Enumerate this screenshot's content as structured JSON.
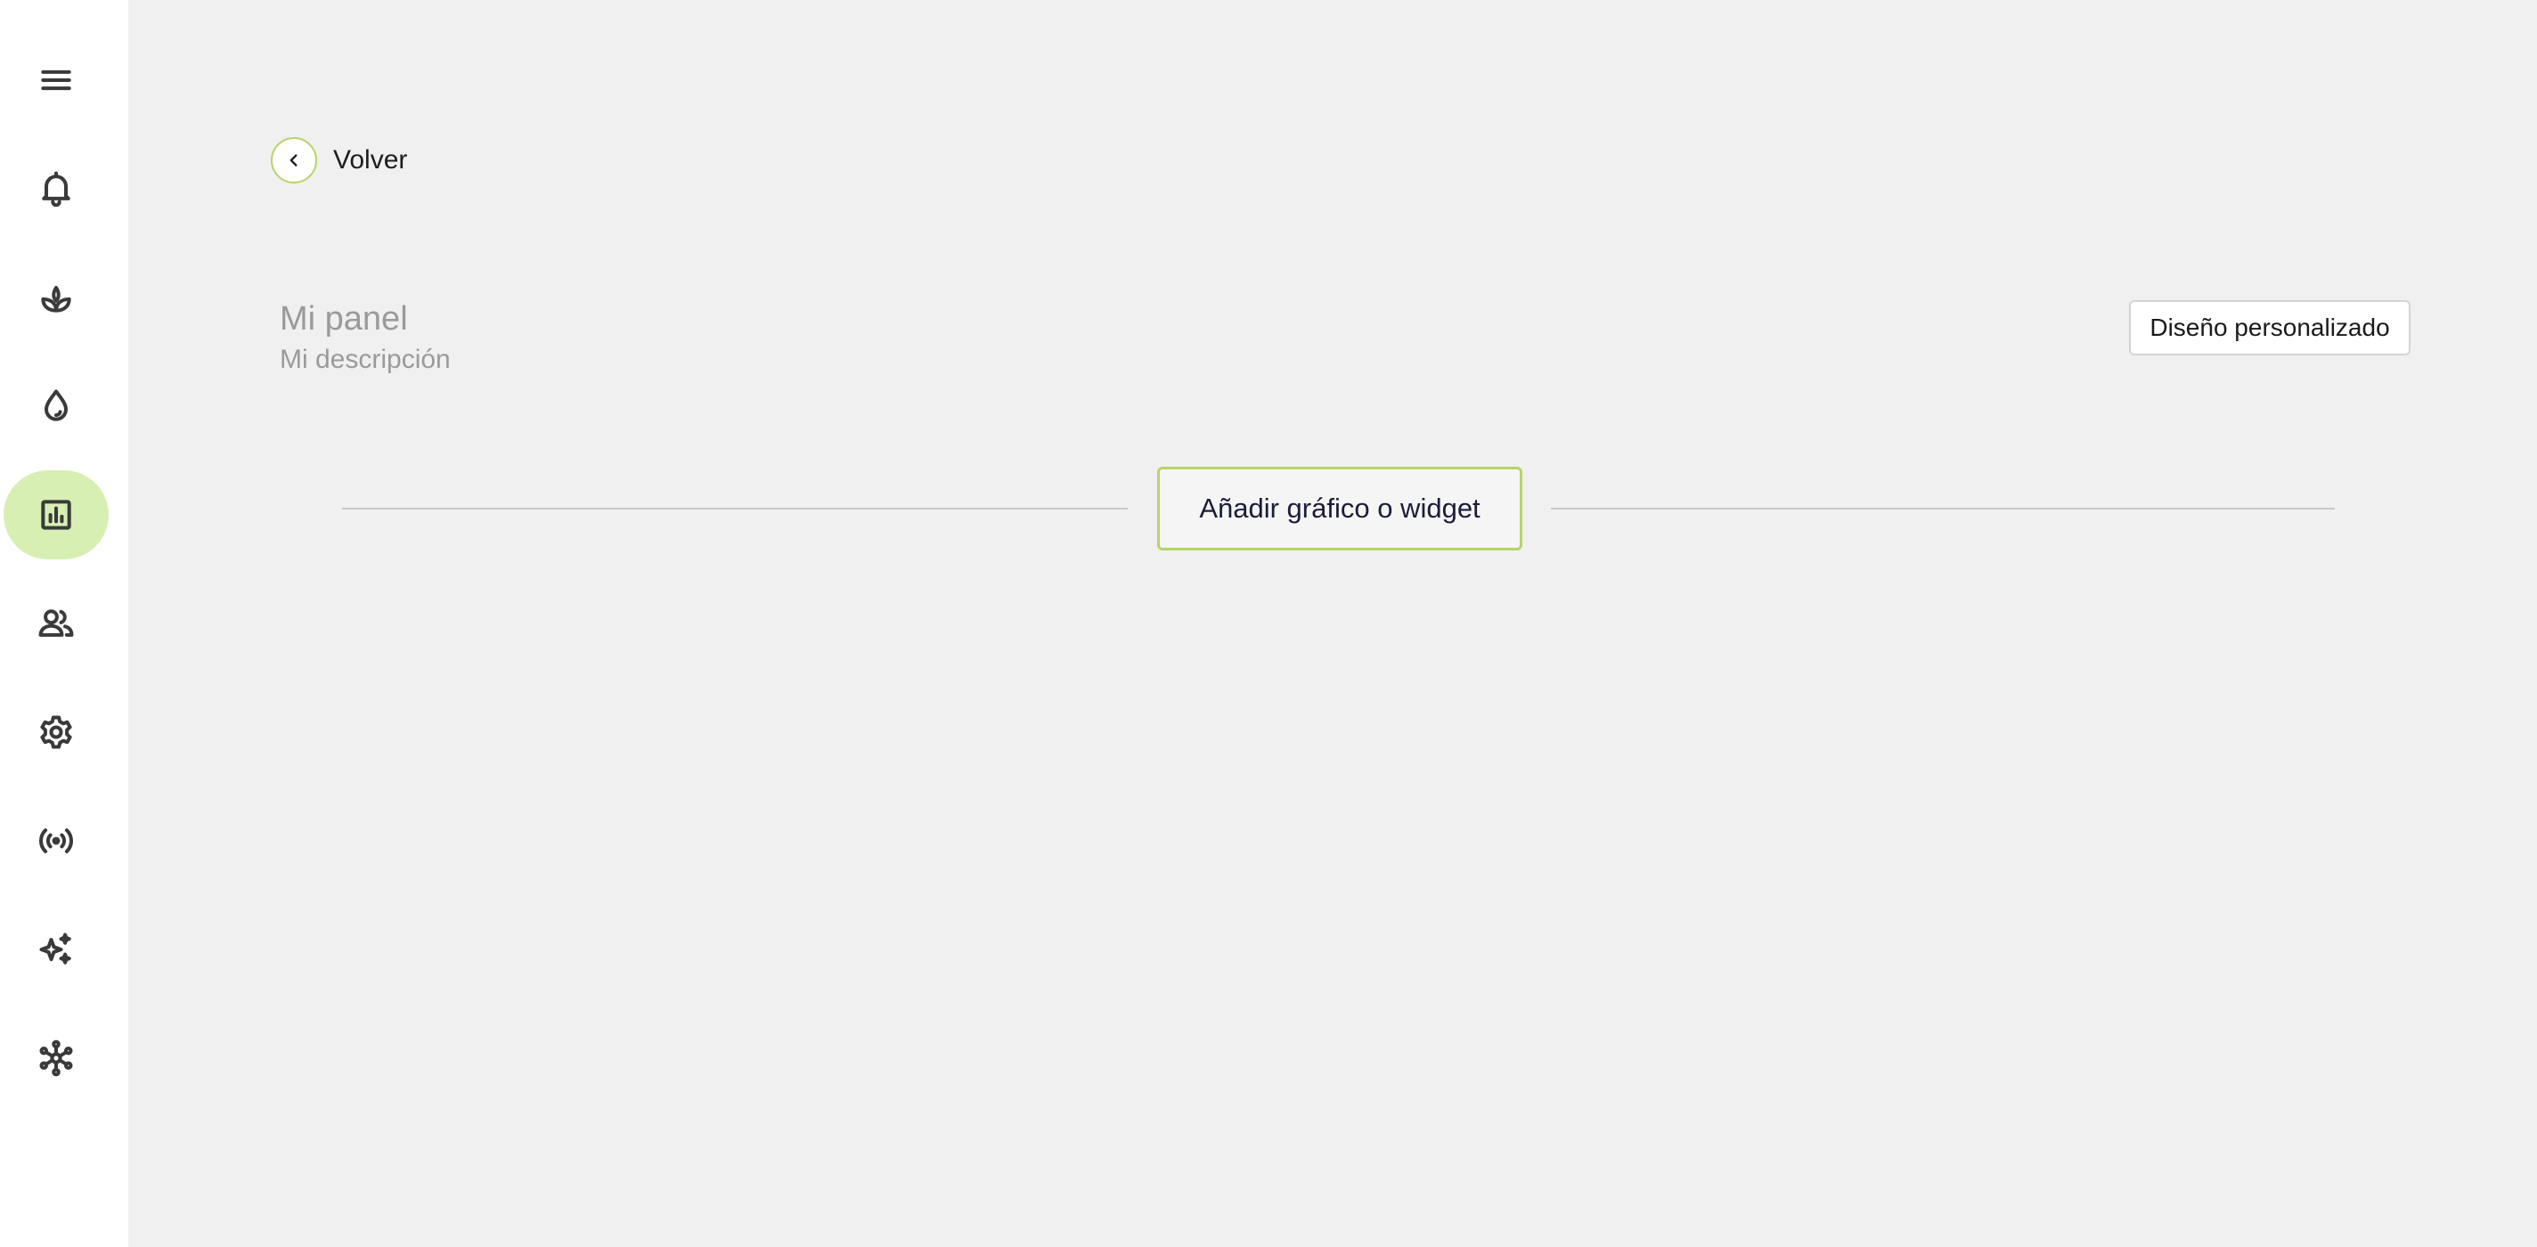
{
  "sidebar": {
    "items": [
      {
        "icon": "menu-icon"
      },
      {
        "icon": "bell-icon"
      },
      {
        "icon": "sprout-icon"
      },
      {
        "icon": "water-drop-icon"
      },
      {
        "icon": "chart-icon",
        "active": true
      },
      {
        "icon": "users-icon"
      },
      {
        "icon": "gear-icon"
      },
      {
        "icon": "broadcast-icon"
      },
      {
        "icon": "sparkles-icon"
      },
      {
        "icon": "network-icon"
      }
    ]
  },
  "header": {
    "back_label": "Volver"
  },
  "panel": {
    "title": "Mi panel",
    "description": "Mi descripción",
    "custom_design_label": "Diseño personalizado"
  },
  "main": {
    "add_widget_label": "Añadir gráfico o widget"
  },
  "colors": {
    "accent": "#b8d468",
    "active_nav_bg": "#d8efb4",
    "background": "#f0f0f0"
  }
}
